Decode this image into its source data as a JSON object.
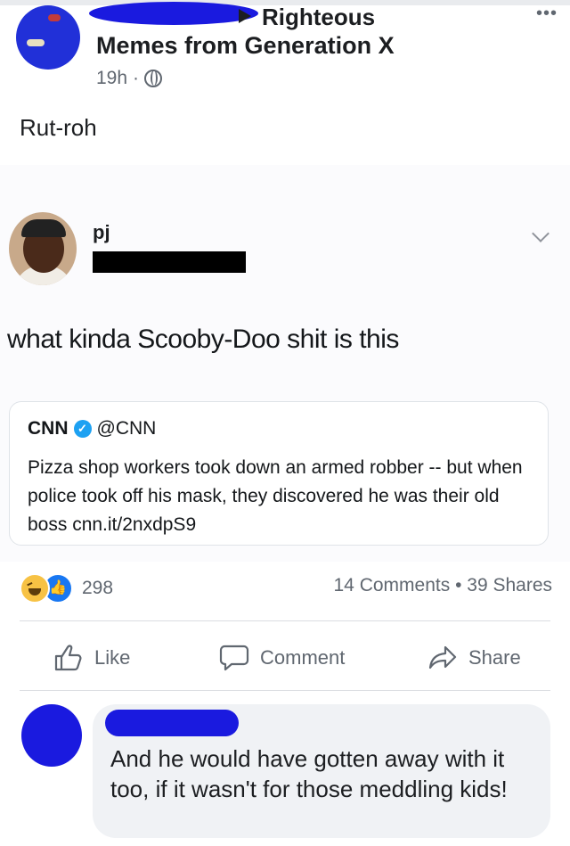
{
  "group_header": {
    "group_name_line1": "Righteous",
    "group_name_line2": "Memes from Generation X",
    "time": "19h",
    "dot": "·",
    "privacy_icon": "globe-icon",
    "more_label": "•••"
  },
  "post": {
    "text": "Rut-roh"
  },
  "screenshot": {
    "author_name": "pj",
    "tweet_text": "what kinda Scooby-Doo shit is this",
    "quote": {
      "source": "CNN",
      "verified_icon": "verified-badge-icon",
      "handle": "@CNN",
      "text": "Pizza shop workers took down an armed robber -- but when police took off his mask, they discovered he was their old boss cnn.it/2nxdpS9"
    }
  },
  "engagement": {
    "reaction_count": "298",
    "comments": "14 Comments",
    "separator": "•",
    "shares": "39 Shares"
  },
  "actions": {
    "like": "Like",
    "comment": "Comment",
    "share": "Share"
  },
  "comment": {
    "text": "And he would have gotten away with it too, if it wasn't for those meddling kids!"
  },
  "colors": {
    "scribble": "#1a1adf",
    "fb_blue": "#1877f2",
    "muted": "#606770"
  }
}
